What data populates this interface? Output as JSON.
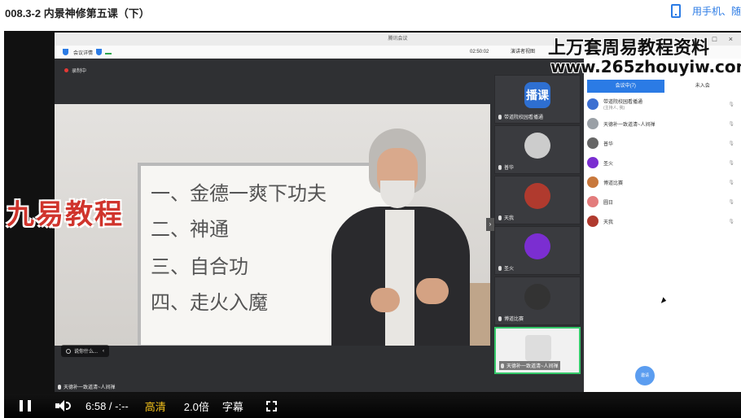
{
  "page": {
    "title": "008.3-2 内景神修第五课（下）",
    "mobile_link": "用手机、随"
  },
  "meeting": {
    "window_title": "腾讯会议",
    "info_label": "会议详情",
    "timer": "02:50:02",
    "layout_label": "演讲者视图",
    "recording_label": "录制中",
    "ask_badge": "说你什么...",
    "active_speaker": "天德补一致道清~人间禅",
    "whiteboard_lines": [
      "一、金德一爽下功夫",
      "二、神通",
      "三、自合功",
      "四、走火入魔"
    ],
    "panel_tabs": [
      "会议中(7)",
      "未入会"
    ],
    "participants": [
      {
        "name": "带道院校园看播通",
        "role": "(主持人, 我)",
        "color": "#3c6fd1"
      },
      {
        "name": "天德补一致道清~人间禅",
        "role": "",
        "color": "#9aa0a6"
      },
      {
        "name": "普华",
        "role": "",
        "color": "#666666"
      },
      {
        "name": "圣火",
        "role": "",
        "color": "#7b2ed1"
      },
      {
        "name": "博道比赛",
        "role": "",
        "color": "#c8783c"
      },
      {
        "name": "圆日",
        "role": "",
        "color": "#e37c7c"
      },
      {
        "name": "天我",
        "role": "",
        "color": "#b03a2e"
      }
    ],
    "tiles": [
      {
        "label": "带道院校园看播通",
        "avatar_text": "播课",
        "color": "#2e6fd1",
        "active": false
      },
      {
        "label": "普华",
        "avatar_text": "",
        "color": "#cccccc",
        "active": false
      },
      {
        "label": "天我",
        "avatar_text": "",
        "color": "#b03a2e",
        "active": false
      },
      {
        "label": "圣火",
        "avatar_text": "",
        "color": "#7b2ed1",
        "active": false
      },
      {
        "label": "博道比赛",
        "avatar_text": "",
        "color": "#333333",
        "active": false
      },
      {
        "label": "天德补一致道清~人间禅",
        "avatar_text": "",
        "color": "#dddddd",
        "active": true
      }
    ],
    "invite_label": "邀请"
  },
  "watermark": {
    "title": "上万套周易教程资料",
    "url": "www.265zhouyiw.com",
    "logo": "九易教程"
  },
  "controls": {
    "time": "6:58 / -:--",
    "quality": "高清",
    "speed": "2.0倍",
    "subtitle": "字幕"
  },
  "colors": {
    "accent": "#2b7be5",
    "quality": "#f4c21b",
    "logo": "#d0342c",
    "active_tile": "#35c96a"
  }
}
